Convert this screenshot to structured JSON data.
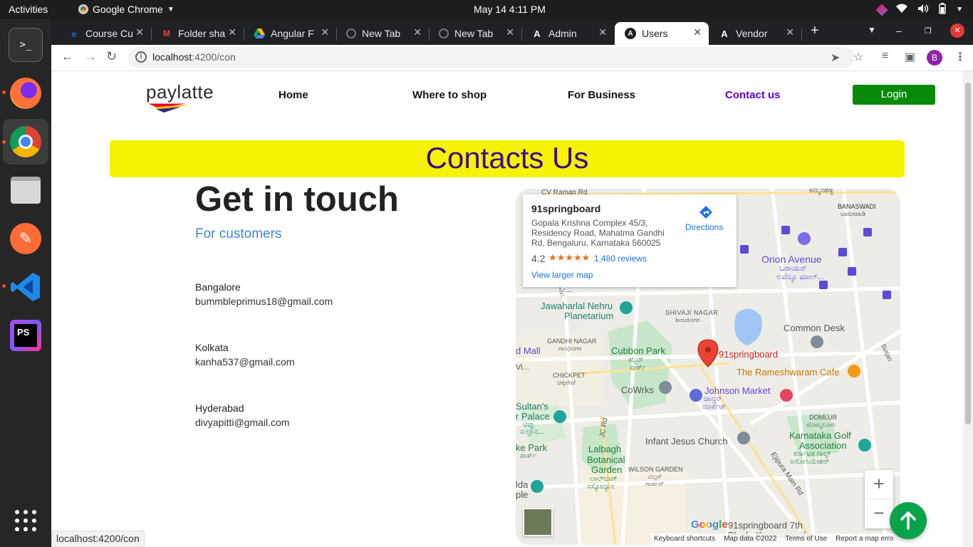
{
  "system": {
    "activities": "Activities",
    "app_name": "Google Chrome",
    "clock": "May 14  4:11 PM"
  },
  "tabs": [
    {
      "label": "Course Cu",
      "favicon": "e-icon"
    },
    {
      "label": "Folder sha",
      "favicon": "gmail-icon"
    },
    {
      "label": "Angular F",
      "favicon": "drive-icon"
    },
    {
      "label": "New Tab",
      "favicon": "globe-icon"
    },
    {
      "label": "New Tab",
      "favicon": "globe-icon"
    },
    {
      "label": "Admin",
      "favicon": "angular-icon"
    },
    {
      "label": "Users",
      "favicon": "angular-icon",
      "active": true
    },
    {
      "label": "Vendor",
      "favicon": "angular-icon"
    }
  ],
  "address_bar": {
    "host": "localhost",
    "path": ":4200/con"
  },
  "profile_initial": "B",
  "site": {
    "logo": "paylatte",
    "nav": {
      "home": "Home",
      "where_to_shop": "Where to shop",
      "for_business": "For Business",
      "contact_us": "Contact us",
      "login": "Login"
    },
    "banner": "Contacts Us",
    "heading": "Get in touch",
    "subheading": "For customers",
    "contacts": [
      {
        "city": "Bangalore",
        "email": "bummbleprimus18@gmail.com"
      },
      {
        "city": "Kolkata",
        "email": "kanha537@gmail.com"
      },
      {
        "city": "Hyderabad",
        "email": "divyapitti@gmail.com"
      }
    ]
  },
  "map": {
    "place_name": "91springboard",
    "address": "Gopala Krishna Complex 45/3, Residency Road, Mahatma Gandhi Rd, Bengaluru, Karnataka 560025",
    "rating": "4.2",
    "stars": "★★★★★",
    "reviews": "1,480 reviews",
    "view_larger": "View larger map",
    "directions": "Directions",
    "labels": {
      "cv_raman": "CV Raman Rd",
      "kammanahalli": "ಕಮ್ಮನಹಳ್ಳಿ",
      "banaswadi": "BANASWADI",
      "banaswadi_kn": "ಬಾಣಸವಾಡಿ",
      "orion": "Orion Avenue",
      "orion_kn": "ಒರಾಯನ್",
      "orion_kn2": "ಅವೆನ್ಯೂ ಮಾಲ್...",
      "planetarium_1": "Jawaharlal Nehru",
      "planetarium_2": "Planetarium",
      "shivaji": "SHIVAJI NAGAR",
      "shivaji_kn": "ಶಿವಾಜಿನಗರ",
      "common_desk": "Common Desk",
      "gandhi": "GANDHI NAGAR",
      "gandhi_kn": "ಗಾಂಧಿನಗರ",
      "cubbon": "Cubbon Park",
      "cubbon_kn": "ಕಬ್ಬನ್",
      "cubbon_kn2": "ಪಾರ್ಕ್",
      "marker_label": "91springboard",
      "rameshwaram": "The Rameshwaram Cafe",
      "chickpet": "CHICKPET",
      "chickpet_kn": "ಚಿಕ್ಕಪೇಟೆ",
      "cowrks": "CoWrks",
      "johnson": "Johnson Market",
      "johnson_kn": "ಜಾನ್ಸನ್",
      "johnson_kn2": "ಮಾರ್ಕೆಟ್",
      "sultan_1": "Sultan's",
      "sultan_2": "r Palace",
      "sultan_kn": "ಟಿಪ್ಪು",
      "sultan_kn2": "ಸುಲ್ತಾನ...",
      "domlur": "DOMLUR",
      "domlur_kn": "ದೊಮ್ಮಲೂರು",
      "jc_road": "JC Rd",
      "infant": "Infant Jesus Church",
      "golf_1": "Karnataka Golf",
      "golf_2": "Association",
      "golf_kn": "ಕರ್ನಾಟಕ ಗಾಲ್ಫ್",
      "golf_kn2": "ಅಸೋಸಿಯೇಶನ್",
      "lalbagh_1": "Lalbagh",
      "lalbagh_2": "Botanical",
      "lalbagh_3": "Garden",
      "lalbagh_kn": "ಲಾಲ್‌ಬಾಗ್",
      "lalbagh_kn2": "ಸಸ್ಯೋದ್ಯಾನ",
      "wilson": "WILSON GARDEN",
      "wilson_kn": "ವಿಲ್ಸನ್",
      "wilson_kn2": "ಗಾರ್ಡನ್",
      "ejipura": "Ejipura Main Rd",
      "park_left": "ke Park",
      "park_left_kn": "ಪಾರ್ಕ್",
      "mall_left": "d Mall",
      "vi_left": "Vi...",
      "lda": "lda",
      "ple": "ple",
      "springboard_7th": "91springboard 7th",
      "koramangala": "Block, Koramangala",
      "surjan": "Surjan",
      "stree": "ಸ್ಟ್ರೀ..."
    },
    "zoom_in": "+",
    "zoom_out": "−",
    "google": "Google",
    "footer": {
      "shortcuts": "Keyboard shortcuts",
      "data": "Map data ©2022",
      "terms": "Terms of Use",
      "report": "Report a map erro"
    }
  },
  "status_url": "localhost:4200/con"
}
